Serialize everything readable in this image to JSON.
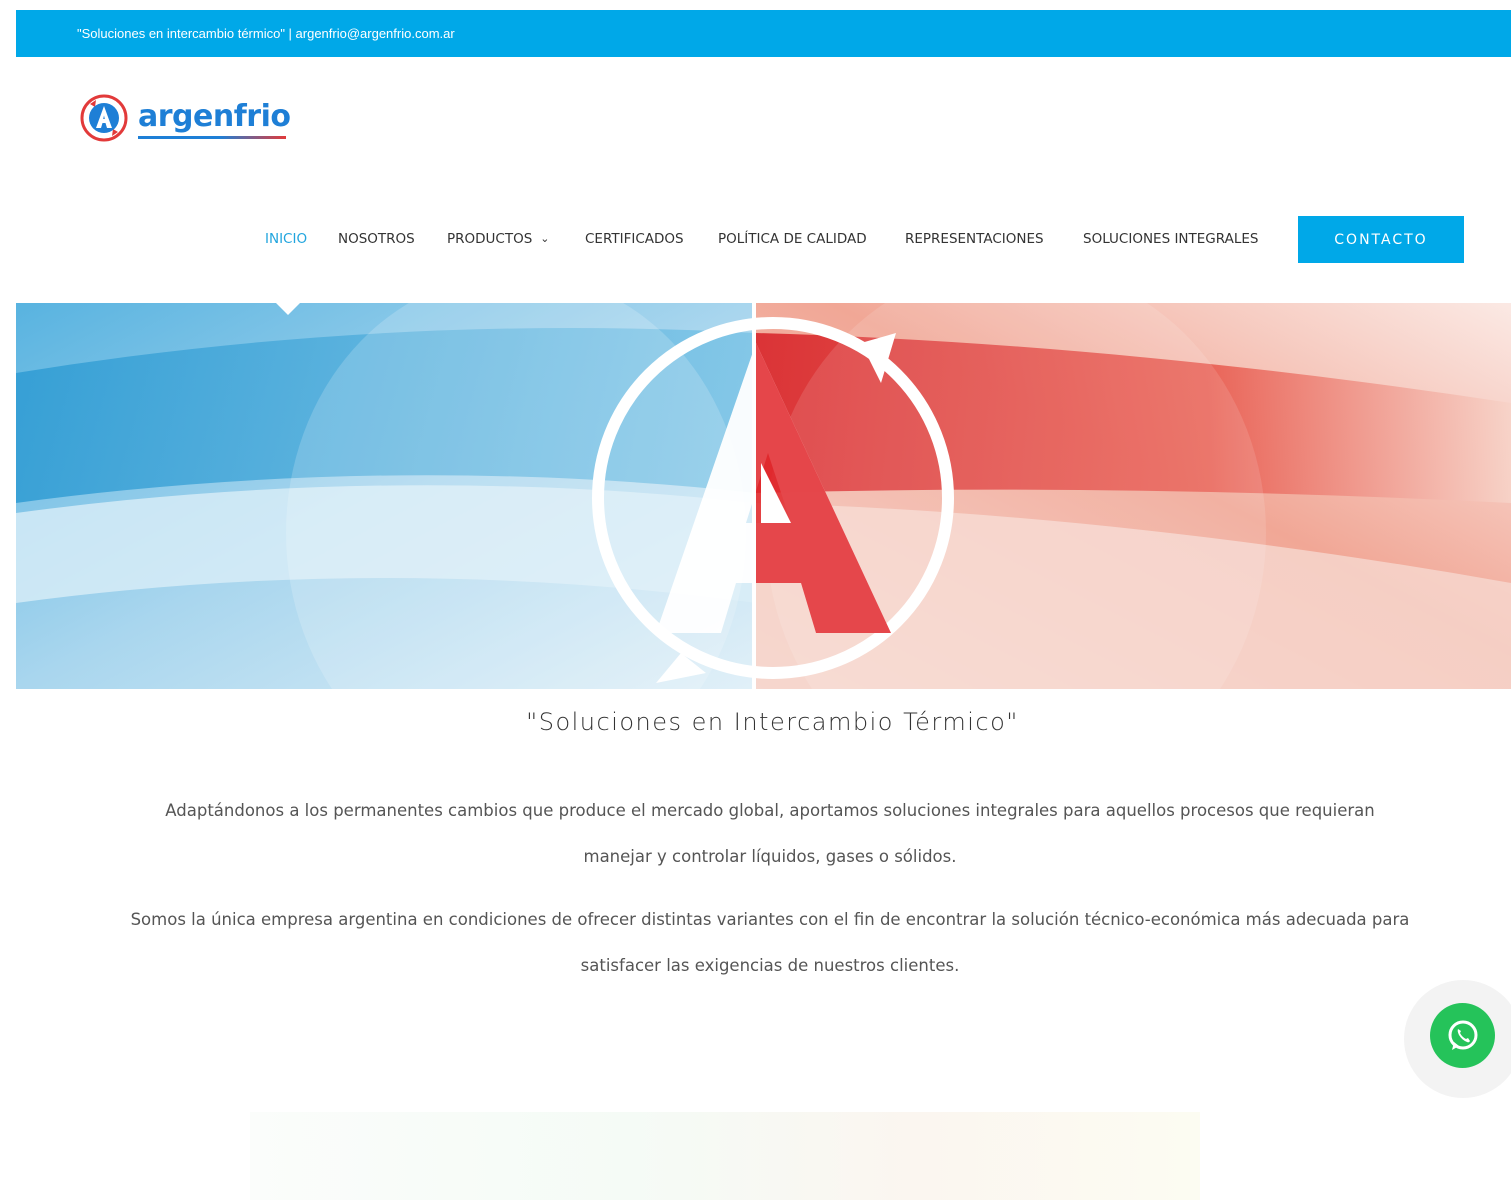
{
  "topbar": {
    "text": "\"Soluciones en intercambio térmico\" | argenfrio@argenfrio.com.ar"
  },
  "logo": {
    "text": "argenfrio",
    "icon": "argenfrio-a-logo-icon"
  },
  "nav": {
    "items": [
      {
        "label": "INICIO",
        "active": true
      },
      {
        "label": "NOSOTROS"
      },
      {
        "label": "PRODUCTOS",
        "has_dropdown": true
      },
      {
        "label": "CERTIFICADOS"
      },
      {
        "label": "POLÍTICA DE CALIDAD"
      },
      {
        "label": "REPRESENTACIONES"
      },
      {
        "label": "SOLUCIONES INTEGRALES"
      }
    ],
    "cta": "CONTACTO"
  },
  "main": {
    "tagline": "\"Soluciones en Intercambio Térmico\"",
    "paragraph1": "Adaptándonos a los permanentes cambios que produce el mercado global, aportamos soluciones integrales para aquellos procesos que requieran manejar y controlar líquidos, gases o sólidos.",
    "paragraph2": "Somos la única empresa argentina en condiciones de ofrecer distintas variantes con el fin de encontrar la solución técnico-económica más adecuada para satisfacer las exigencias de nuestros clientes."
  },
  "colors": {
    "brand_blue": "#00a8e8",
    "nav_active": "#21a5de",
    "brand_red": "#e23a3a",
    "whatsapp_green": "#25c35a"
  },
  "widgets": {
    "whatsapp_icon": "whatsapp-icon"
  }
}
